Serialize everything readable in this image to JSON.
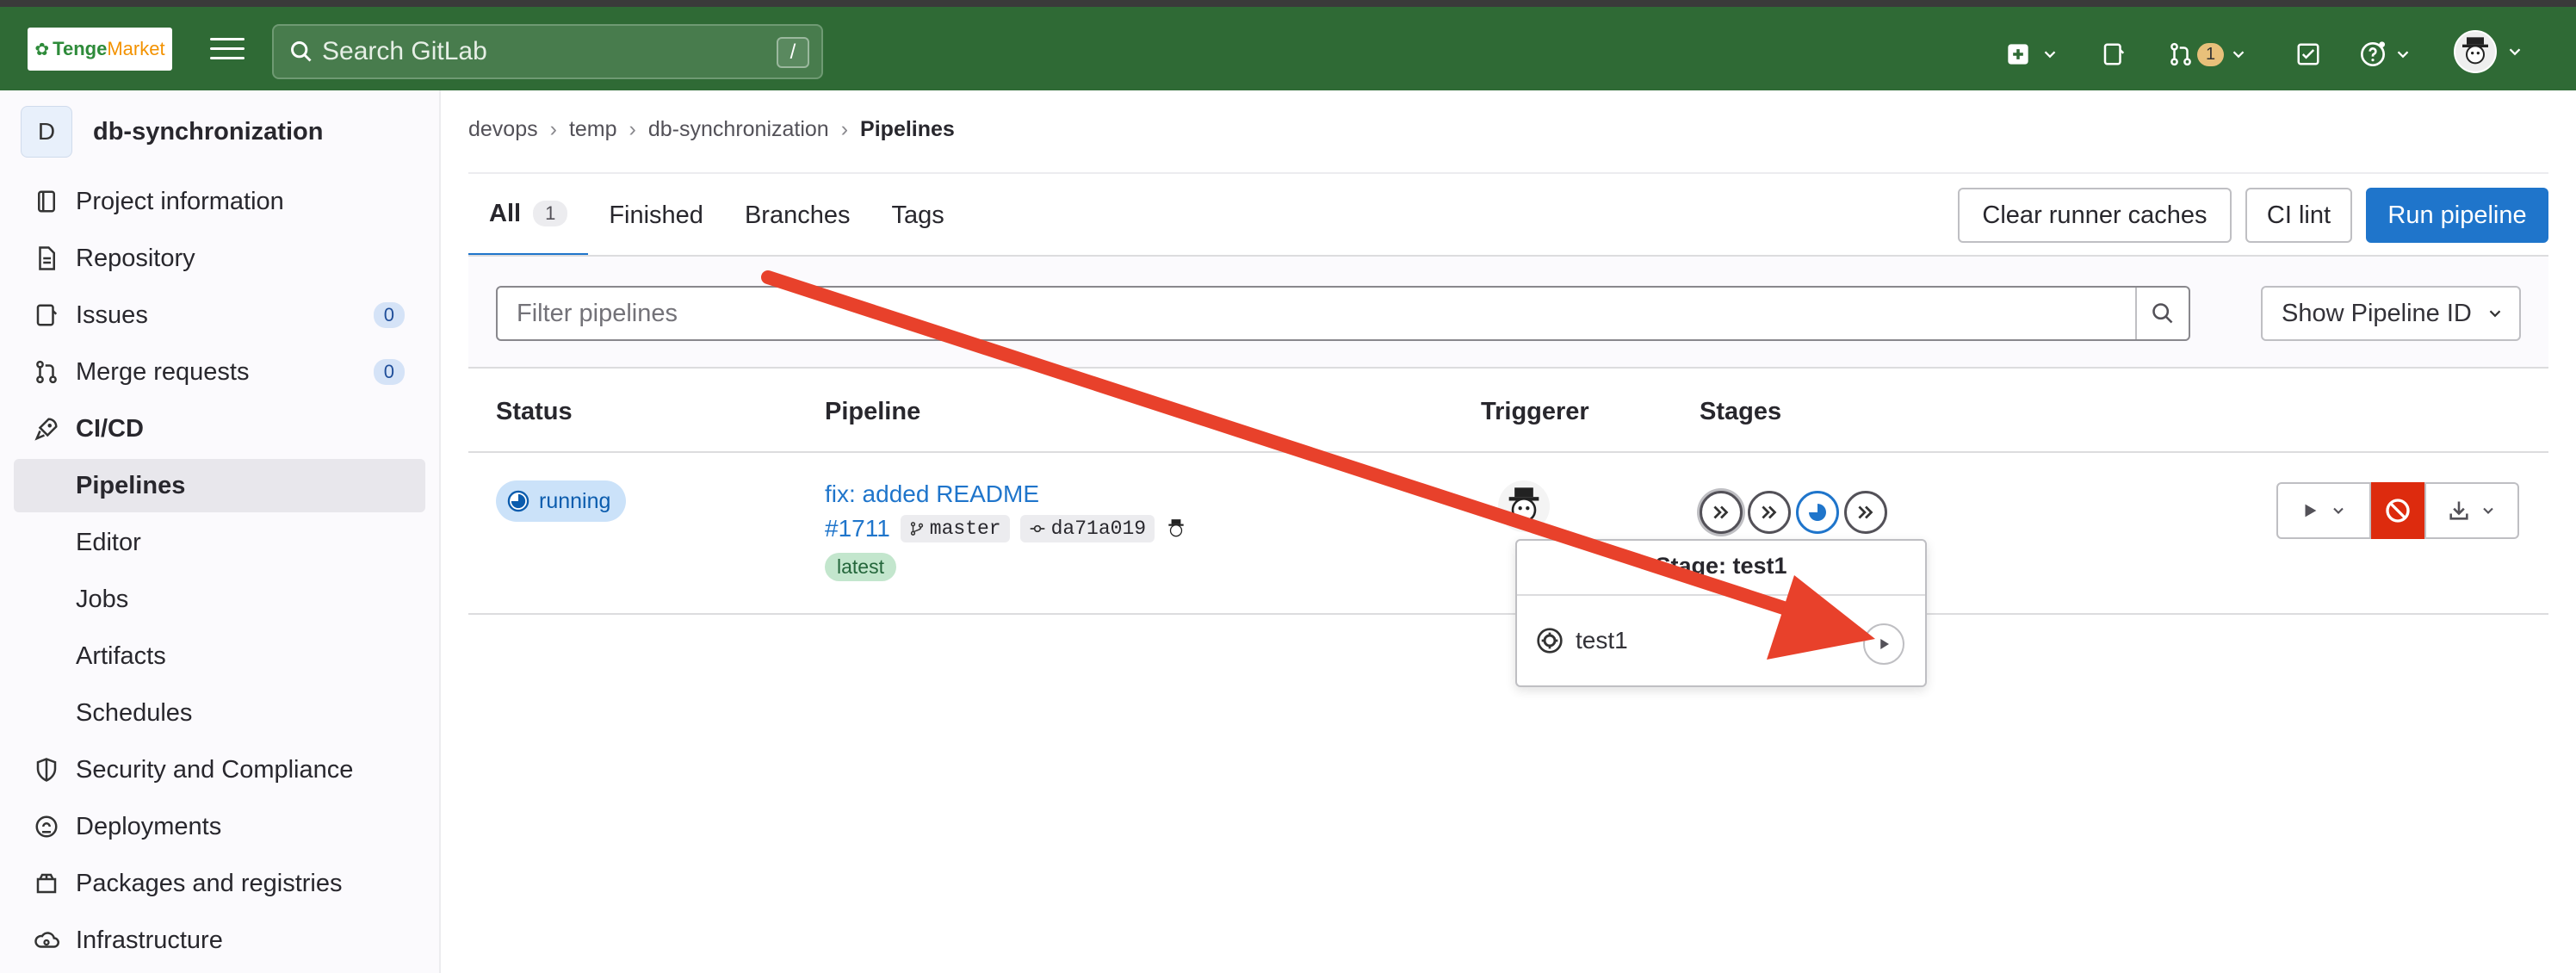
{
  "topbar": {
    "logo_primary": "Tenge",
    "logo_secondary": "Market",
    "search_placeholder": "Search GitLab",
    "search_shortcut": "/",
    "mr_count": "1",
    "colors": {
      "header_bg": "#2f6a35",
      "accent": "#1f75cb",
      "danger": "#dd2b0e"
    }
  },
  "sidebar": {
    "project_initial": "D",
    "project_name": "db-synchronization",
    "items": [
      {
        "label": "Project information",
        "icon": "info-icon"
      },
      {
        "label": "Repository",
        "icon": "document-icon"
      },
      {
        "label": "Issues",
        "icon": "issues-icon",
        "count": "0"
      },
      {
        "label": "Merge requests",
        "icon": "merge-request-icon",
        "count": "0"
      },
      {
        "label": "CI/CD",
        "icon": "rocket-icon"
      },
      {
        "label": "Pipelines"
      },
      {
        "label": "Editor"
      },
      {
        "label": "Jobs"
      },
      {
        "label": "Artifacts"
      },
      {
        "label": "Schedules"
      },
      {
        "label": "Security and Compliance",
        "icon": "shield-icon"
      },
      {
        "label": "Deployments",
        "icon": "deployments-icon"
      },
      {
        "label": "Packages and registries",
        "icon": "package-icon"
      },
      {
        "label": "Infrastructure",
        "icon": "cloud-gear-icon"
      }
    ]
  },
  "breadcrumbs": [
    "devops",
    "temp",
    "db-synchronization",
    "Pipelines"
  ],
  "tabs": [
    {
      "label": "All",
      "count": "1"
    },
    {
      "label": "Finished"
    },
    {
      "label": "Branches"
    },
    {
      "label": "Tags"
    }
  ],
  "header_buttons": {
    "clear_caches": "Clear runner caches",
    "ci_lint": "CI lint",
    "run_pipeline": "Run pipeline"
  },
  "filter": {
    "placeholder": "Filter pipelines",
    "select_label": "Show Pipeline ID"
  },
  "table": {
    "headers": [
      "Status",
      "Pipeline",
      "Triggerer",
      "Stages"
    ],
    "rows": [
      {
        "status": "running",
        "title": "fix: added README",
        "id": "#1711",
        "branch": "master",
        "commit": "da71a019",
        "tag": "latest"
      }
    ]
  },
  "popover": {
    "title": "Stage: test1",
    "job_name": "test1"
  }
}
